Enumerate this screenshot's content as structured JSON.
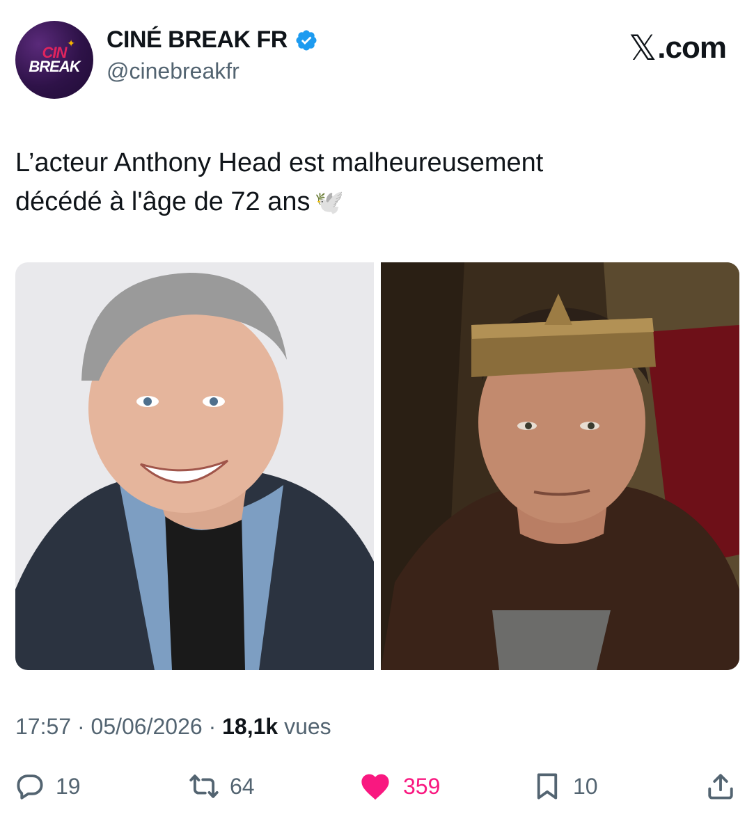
{
  "account": {
    "avatar_line1": "CIN",
    "avatar_line2": "BREAK",
    "display_name": "CINÉ BREAK FR",
    "handle": "@cinebreakfr",
    "verified_color": "#1d9bf0"
  },
  "brand": {
    "x_glyph": "𝕏",
    "domain": ".com"
  },
  "tweet": {
    "line1": "L’acteur Anthony Head est malheureusement",
    "line2": "décédé à l'âge de 72 ans",
    "emoji": "🕊️"
  },
  "meta": {
    "time": "17:57",
    "separator": "·",
    "date": "05/06/2026",
    "views_count": "18,1k",
    "views_label": "vues"
  },
  "actions": {
    "replies": "19",
    "reposts": "64",
    "likes": "359",
    "bookmarks": "10"
  },
  "colors": {
    "like": "#f91880",
    "secondary_text": "#536471"
  }
}
